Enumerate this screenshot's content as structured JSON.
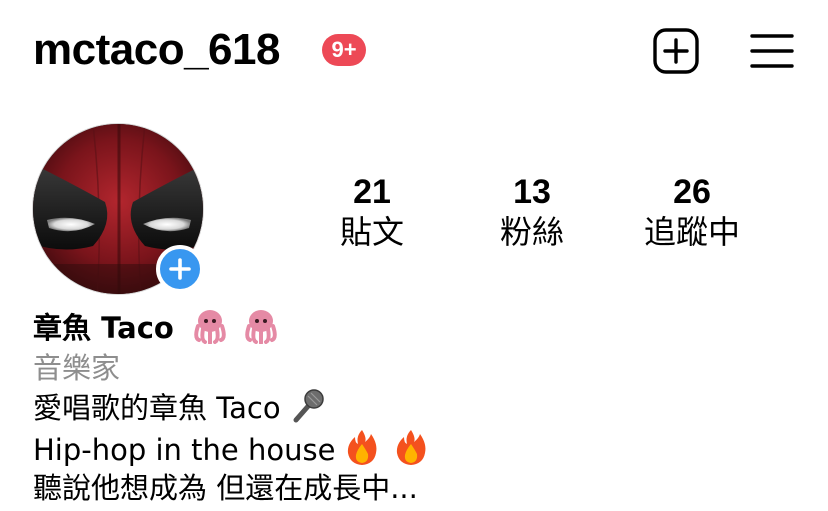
{
  "header": {
    "username": "mctaco_618",
    "notification_badge": "9+",
    "new_post_icon": "plus-square-icon",
    "menu_icon": "hamburger-menu-icon"
  },
  "profile": {
    "avatar": "avatar",
    "add_story_icon": "plus-icon",
    "stats": [
      {
        "value": "21",
        "label": "貼文"
      },
      {
        "value": "13",
        "label": "粉絲"
      },
      {
        "value": "26",
        "label": "追蹤中"
      }
    ]
  },
  "bio": {
    "display_name": "章魚 Taco",
    "name_emojis": [
      "octopus-emoji",
      "octopus-emoji"
    ],
    "category": "音樂家",
    "line1": "愛唱歌的章魚 Taco",
    "line1_emoji": "microphone-emoji",
    "line2": "Hip-hop in the house",
    "line2_emojis": [
      "fire-emoji",
      "fire-emoji"
    ],
    "line3": "聽說他想成為 但還在成長中..."
  },
  "colors": {
    "badge": "#ed4956",
    "accent_blue": "#3897f0",
    "category_gray": "#8e8e8e",
    "text": "#000000"
  }
}
